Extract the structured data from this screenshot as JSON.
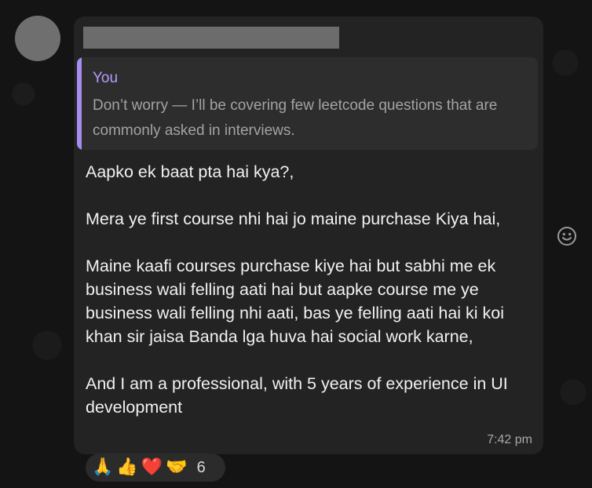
{
  "message": {
    "reply": {
      "author": "You",
      "text": "Don’t worry — I’ll be covering few leetcode questions that are commonly asked in interviews."
    },
    "body": "Aapko ek baat pta hai kya?,\n\nMera ye first course nhi hai jo maine purchase Kiya hai,\n\nMaine kaafi courses purchase kiye hai but sabhi me ek business wali felling aati hai but aapke course me ye business wali felling nhi aati, bas ye felling aati hai ki koi khan sir jaisa Banda lga huva hai social work karne,\n\nAnd I am a professional, with 5 years of experience in UI development",
    "time": "7:42 pm"
  },
  "reactions": {
    "emojis": [
      "🙏",
      "👍",
      "❤️",
      "🤝"
    ],
    "count": "6"
  },
  "icons": {
    "emoji_button": "smiley-icon"
  },
  "colors": {
    "reply_accent": "#a88cf0",
    "bubble": "#232323"
  }
}
